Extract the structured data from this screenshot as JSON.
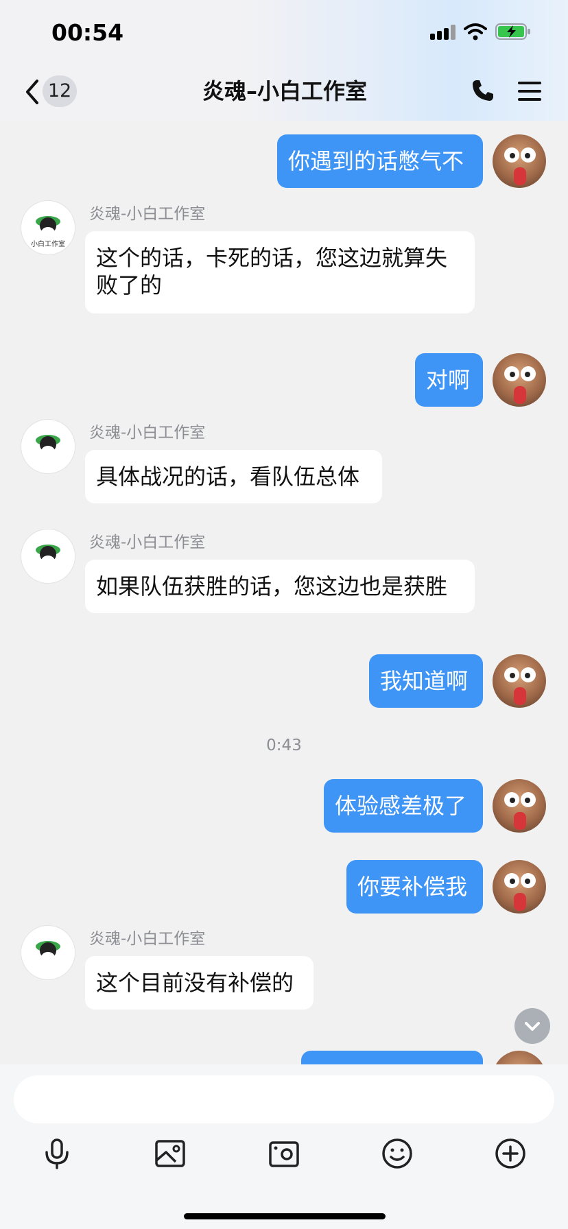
{
  "status_bar": {
    "time": "00:54"
  },
  "nav": {
    "unread_count": "12",
    "title": "炎魂–小白工作室"
  },
  "messages": [
    {
      "side": "me",
      "text": "你遇到的话憋气不"
    },
    {
      "side": "them",
      "sender": "炎魂-小白工作室",
      "text": "这个的话，卡死的话，您这边就算失败了的"
    },
    {
      "side": "me",
      "text": "对啊"
    },
    {
      "side": "them",
      "sender": "炎魂-小白工作室",
      "text": "具体战况的话，看队伍总体"
    },
    {
      "side": "them",
      "sender": "炎魂-小白工作室",
      "text": "如果队伍获胜的话，您这边也是获胜"
    },
    {
      "side": "me",
      "text": "我知道啊"
    },
    {
      "type": "timestamp",
      "text": "0:43"
    },
    {
      "side": "me",
      "text": "体验感差极了"
    },
    {
      "side": "me",
      "text": "你要补偿我"
    },
    {
      "side": "them",
      "sender": "炎魂-小白工作室",
      "text": "这个目前没有补偿的"
    }
  ],
  "avatars": {
    "them_logo_text": "小白工作室"
  },
  "input": {
    "placeholder": ""
  },
  "colors": {
    "my_bubble": "#3f95f6",
    "their_bubble": "#ffffff",
    "background": "#f1f1f1"
  },
  "icons": [
    "back-icon",
    "phone-icon",
    "menu-icon",
    "microphone-icon",
    "image-icon",
    "camera-icon",
    "emoji-icon",
    "plus-icon",
    "chevron-down-icon"
  ]
}
